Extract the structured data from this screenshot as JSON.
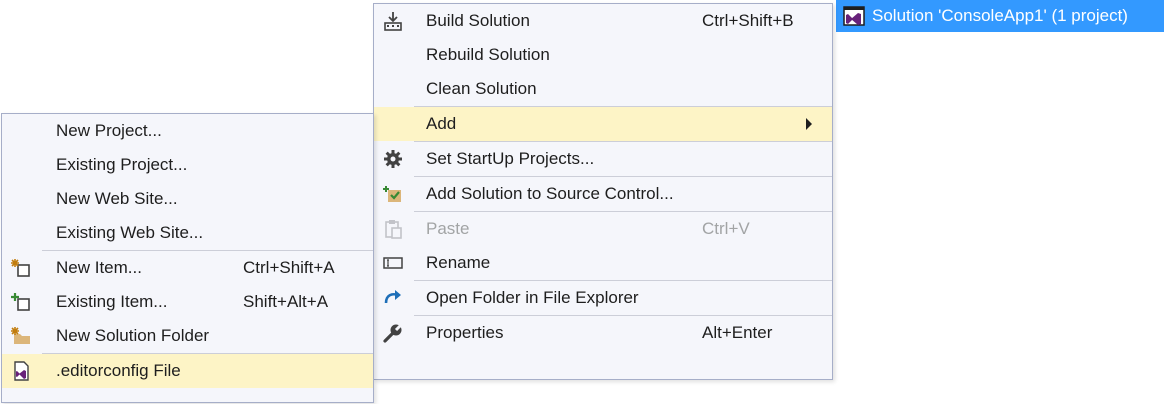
{
  "solution_node": {
    "label": "Solution 'ConsoleApp1' (1 project)",
    "icon": "visual-studio-solution-icon"
  },
  "context_menu": {
    "build_solution": {
      "label": "Build Solution",
      "shortcut": "Ctrl+Shift+B",
      "icon": "build-icon"
    },
    "rebuild_solution": {
      "label": "Rebuild Solution"
    },
    "clean_solution": {
      "label": "Clean Solution"
    },
    "add": {
      "label": "Add",
      "icon": "submenu-arrow-icon"
    },
    "set_startup": {
      "label": "Set StartUp Projects...",
      "icon": "gear-icon"
    },
    "add_source_control": {
      "label": "Add Solution to Source Control...",
      "icon": "source-control-add-icon"
    },
    "paste": {
      "label": "Paste",
      "shortcut": "Ctrl+V",
      "icon": "paste-icon"
    },
    "rename": {
      "label": "Rename",
      "icon": "rename-icon"
    },
    "open_folder": {
      "label": "Open Folder in File Explorer",
      "icon": "refresh-arrow-icon"
    },
    "properties": {
      "label": "Properties",
      "shortcut": "Alt+Enter",
      "icon": "wrench-icon"
    }
  },
  "add_submenu": {
    "new_project": {
      "label": "New Project..."
    },
    "existing_project": {
      "label": "Existing Project..."
    },
    "new_web_site": {
      "label": "New Web Site..."
    },
    "existing_web_site": {
      "label": "Existing Web Site..."
    },
    "new_item": {
      "label": "New Item...",
      "shortcut": "Ctrl+Shift+A",
      "icon": "new-item-icon"
    },
    "existing_item": {
      "label": "Existing Item...",
      "shortcut": "Shift+Alt+A",
      "icon": "existing-item-icon"
    },
    "new_solution_folder": {
      "label": "New Solution Folder",
      "icon": "new-folder-icon"
    },
    "editorconfig": {
      "label": ".editorconfig File",
      "icon": "editorconfig-file-icon"
    }
  },
  "colors": {
    "selection_blue": "#3399ff",
    "menu_background": "#f5f6fb",
    "menu_border": "#a6aec8",
    "highlight": "#fdf4c6",
    "disabled_text": "#a2a4a5"
  }
}
